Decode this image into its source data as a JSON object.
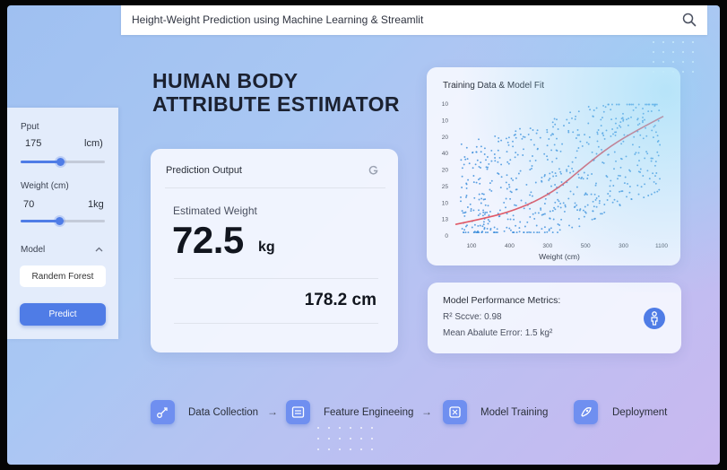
{
  "topbar": {
    "title": "Height-Weight Prediction using Machine Learning & Streamlit",
    "icon": "search-icon"
  },
  "sidebar": {
    "input_label": "Pput",
    "height_value": "175",
    "height_unit": "lcm)",
    "height_slider_level": 0.47,
    "weight_label": "Weight (cm)",
    "weight_value": "70",
    "weight_unit": "1kg",
    "weight_slider_level": 0.46,
    "model_label": "Model",
    "model_value": "Randem Forest",
    "predict_label": "Predict"
  },
  "hero": {
    "line1": "HUMAN BODY",
    "line2": "ATTRIBUTE ESTIMATOR"
  },
  "prediction": {
    "title": "Prediction Output",
    "estimated_label": "Estimated Weight",
    "weight_value": "72.5",
    "weight_unit": "kg",
    "height_value": "178.2 cm"
  },
  "chart": {
    "title": "Training Data & Model Fit",
    "xlabel": "Weight (cm)"
  },
  "chart_data": {
    "type": "scatter",
    "title": "Training Data & Model Fit",
    "xlabel": "Weight (cm)",
    "ylabel": "",
    "x_ticks": [
      "100",
      "400",
      "300",
      "500",
      "300",
      "1100"
    ],
    "y_ticks": [
      "10",
      "10",
      "20",
      "40",
      "20",
      "25",
      "10",
      "13",
      "0"
    ],
    "series": [
      {
        "kind": "scatter",
        "color": "#3f8fdc"
      },
      {
        "kind": "fit-line",
        "color": "#e05866",
        "x": [
          0,
          0.12,
          0.25,
          0.38,
          0.5,
          0.62,
          0.75,
          0.88,
          1.0
        ],
        "y": [
          0.08,
          0.12,
          0.17,
          0.25,
          0.36,
          0.52,
          0.68,
          0.8,
          0.9
        ]
      }
    ],
    "grid": false,
    "legend": "none"
  },
  "metrics": {
    "title": "Model Performance Metrics:",
    "r2": "R² Sccve: 0.98",
    "mae": "Mean Abalute Error: 1.5 kg²"
  },
  "pipeline": [
    {
      "label": "Data Collection",
      "icon": "data-collection-icon"
    },
    {
      "label": "Feature Engineeing",
      "icon": "feature-engineering-icon"
    },
    {
      "label": "Model Training",
      "icon": "model-training-icon"
    },
    {
      "label": "Deployment",
      "icon": "deployment-icon"
    }
  ],
  "arrow_glyph": "→",
  "colors": {
    "accent": "#4f7ce6",
    "fit_line": "#e05866",
    "points": "#3f8fdc"
  }
}
